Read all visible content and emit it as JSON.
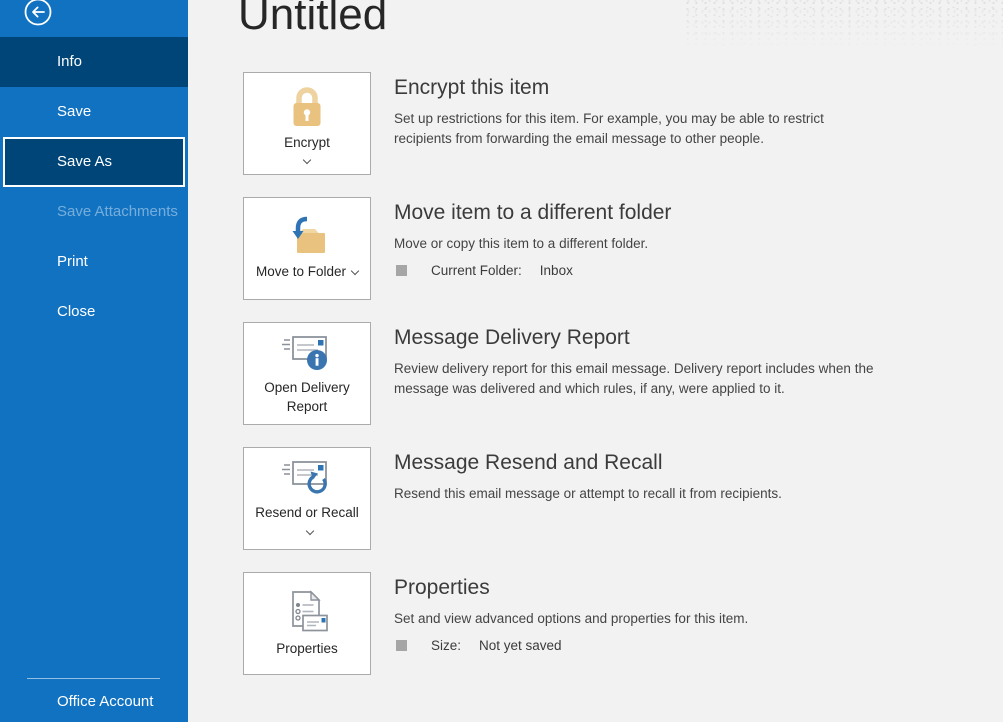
{
  "sidebar": {
    "back_icon": "back-arrow-icon",
    "items": [
      {
        "label": "Info",
        "state": "active"
      },
      {
        "label": "Save",
        "state": "normal"
      },
      {
        "label": "Save As",
        "state": "focused"
      },
      {
        "label": "Save Attachments",
        "state": "disabled"
      },
      {
        "label": "Print",
        "state": "normal"
      },
      {
        "label": "Close",
        "state": "normal"
      }
    ],
    "footer_item": "Office Account"
  },
  "page": {
    "title": "Untitled"
  },
  "sections": [
    {
      "icon": "lock-icon",
      "button_label": "Encrypt",
      "has_dropdown": true,
      "title": "Encrypt this item",
      "description": "Set up restrictions for this item. For example, you may be able to restrict recipients from forwarding the email message to other people."
    },
    {
      "icon": "move-to-folder-icon",
      "button_label": "Move to Folder",
      "has_dropdown": true,
      "title": "Move item to a different folder",
      "description": "Move or copy this item to a different folder.",
      "detail": {
        "label": "Current Folder:",
        "value": "Inbox"
      }
    },
    {
      "icon": "delivery-report-icon",
      "button_label": "Open Delivery Report",
      "has_dropdown": false,
      "title": "Message Delivery Report",
      "description": "Review delivery report for this email message. Delivery report includes when the message was delivered and which rules, if any, were applied to it."
    },
    {
      "icon": "resend-recall-icon",
      "button_label": "Resend or Recall",
      "has_dropdown": true,
      "title": "Message Resend and Recall",
      "description": "Resend this email message or attempt to recall it from recipients."
    },
    {
      "icon": "properties-icon",
      "button_label": "Properties",
      "has_dropdown": false,
      "title": "Properties",
      "description": "Set and view advanced options and properties for this item.",
      "detail": {
        "label": "Size:",
        "value": "Not yet saved"
      }
    }
  ],
  "colors": {
    "sidebar_blue": "#1172c1",
    "sidebar_selected": "#004578",
    "main_background": "#f2f2f2",
    "button_border": "#ababab",
    "accent_gold": "#e9c27f",
    "accent_blue": "#3a75b0",
    "heading_text": "#3b3b3b",
    "body_text": "#444444"
  }
}
